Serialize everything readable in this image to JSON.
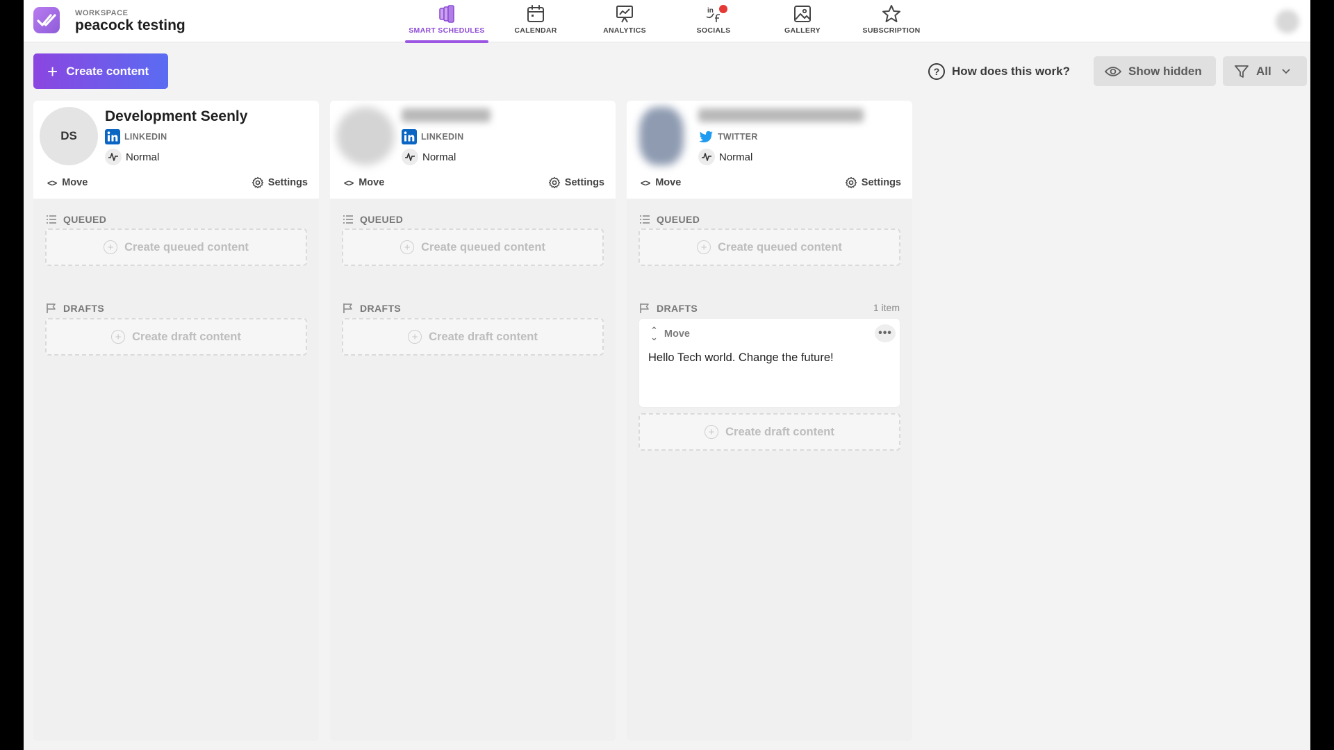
{
  "header": {
    "workspace_label": "WORKSPACE",
    "workspace_name": "peacock testing",
    "nav": [
      {
        "label": "SMART SCHEDULES",
        "icon": "smart-schedules-icon",
        "active": true
      },
      {
        "label": "CALENDAR",
        "icon": "calendar-icon",
        "active": false
      },
      {
        "label": "ANALYTICS",
        "icon": "analytics-icon",
        "active": false
      },
      {
        "label": "SOCIALS",
        "icon": "socials-icon",
        "active": false
      },
      {
        "label": "GALLERY",
        "icon": "gallery-icon",
        "active": false
      },
      {
        "label": "SUBSCRIPTION",
        "icon": "star-icon",
        "active": false
      }
    ]
  },
  "toolbar": {
    "create_label": "Create content",
    "help_label": "How does this work?",
    "show_hidden_label": "Show hidden",
    "filter_label": "All"
  },
  "columns": [
    {
      "initials": "DS",
      "name": "Development Seenly",
      "platform": "LINKEDIN",
      "status": "Normal",
      "move_label": "Move",
      "settings_label": "Settings",
      "queued_label": "QUEUED",
      "queued_action": "Create queued content",
      "drafts_label": "DRAFTS",
      "drafts_action": "Create draft content"
    },
    {
      "initials": "",
      "name": "",
      "platform": "LINKEDIN",
      "status": "Normal",
      "move_label": "Move",
      "settings_label": "Settings",
      "queued_label": "QUEUED",
      "queued_action": "Create queued content",
      "drafts_label": "DRAFTS",
      "drafts_action": "Create draft content"
    },
    {
      "initials": "",
      "name": "",
      "platform": "TWITTER",
      "status": "Normal",
      "move_label": "Move",
      "settings_label": "Settings",
      "queued_label": "QUEUED",
      "queued_action": "Create queued content",
      "drafts_label": "DRAFTS",
      "drafts_count": "1 item",
      "draft_item": {
        "move_label": "Move",
        "menu_label": "•••",
        "text": "Hello Tech world. Change the future!"
      },
      "drafts_action": "Create draft content"
    }
  ],
  "colors": {
    "accent": "#9b56e2",
    "create_gradient_start": "#8b45e0",
    "create_gradient_end": "#5a6cf2",
    "linkedin": "#0a66c2",
    "twitter": "#1d9bf0",
    "notification": "#e53935"
  }
}
